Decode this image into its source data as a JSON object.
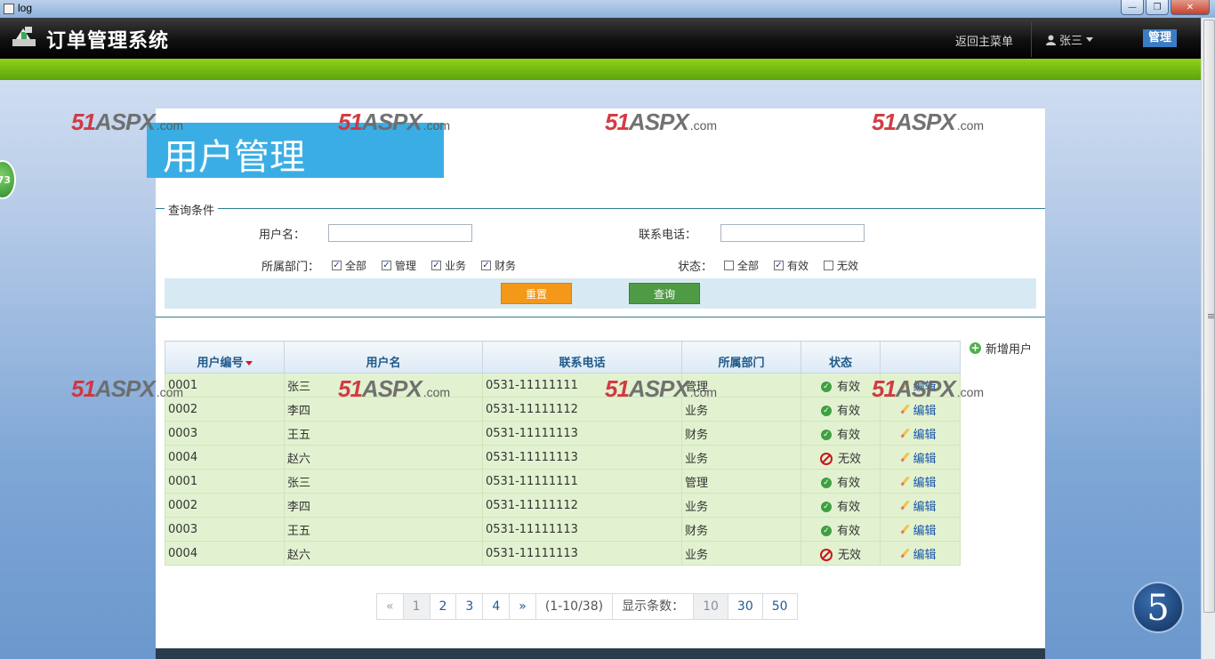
{
  "window": {
    "title": "log"
  },
  "header": {
    "app_title": "订单管理系统",
    "back_link": "返回主菜单",
    "user_name": "张三",
    "admin_label": "管理"
  },
  "page": {
    "title": "用户管理"
  },
  "query": {
    "legend": "查询条件",
    "username_label": "用户名：",
    "username_value": "",
    "phone_label": "联系电话：",
    "phone_value": "",
    "dept_label": "所属部门：",
    "dept_options": [
      {
        "label": "全部",
        "checked": true
      },
      {
        "label": "管理",
        "checked": true
      },
      {
        "label": "业务",
        "checked": true
      },
      {
        "label": "财务",
        "checked": true
      }
    ],
    "status_label": "状态：",
    "status_options": [
      {
        "label": "全部",
        "checked": false
      },
      {
        "label": "有效",
        "checked": true
      },
      {
        "label": "无效",
        "checked": false
      }
    ],
    "reset_label": "重置",
    "search_label": "查询"
  },
  "table": {
    "add_user_label": "新增用户",
    "columns": [
      "用户编号",
      "用户名",
      "联系电话",
      "所属部门",
      "状态",
      ""
    ],
    "edit_label": "编辑",
    "rows": [
      {
        "id": "0001",
        "name": "张三",
        "phone": "0531-11111111",
        "dept": "管理",
        "status": "有效",
        "valid": true
      },
      {
        "id": "0002",
        "name": "李四",
        "phone": "0531-11111112",
        "dept": "业务",
        "status": "有效",
        "valid": true
      },
      {
        "id": "0003",
        "name": "王五",
        "phone": "0531-11111113",
        "dept": "财务",
        "status": "有效",
        "valid": true
      },
      {
        "id": "0004",
        "name": "赵六",
        "phone": "0531-11111113",
        "dept": "业务",
        "status": "无效",
        "valid": false
      },
      {
        "id": "0001",
        "name": "张三",
        "phone": "0531-11111111",
        "dept": "管理",
        "status": "有效",
        "valid": true
      },
      {
        "id": "0002",
        "name": "李四",
        "phone": "0531-11111112",
        "dept": "业务",
        "status": "有效",
        "valid": true
      },
      {
        "id": "0003",
        "name": "王五",
        "phone": "0531-11111113",
        "dept": "财务",
        "status": "有效",
        "valid": true
      },
      {
        "id": "0004",
        "name": "赵六",
        "phone": "0531-11111113",
        "dept": "业务",
        "status": "无效",
        "valid": false
      }
    ]
  },
  "pager": {
    "prev": "«",
    "pages": [
      "1",
      "2",
      "3",
      "4"
    ],
    "current": "1",
    "next": "»",
    "range": "(1-10/38)",
    "size_label": "显示条数：",
    "sizes": [
      "10",
      "30",
      "50"
    ],
    "current_size": "10"
  },
  "widgets": {
    "side_bubble": "73",
    "badge": "5"
  },
  "watermark": {
    "main": "51",
    "aspx": "ASPX",
    "com": ".com"
  }
}
